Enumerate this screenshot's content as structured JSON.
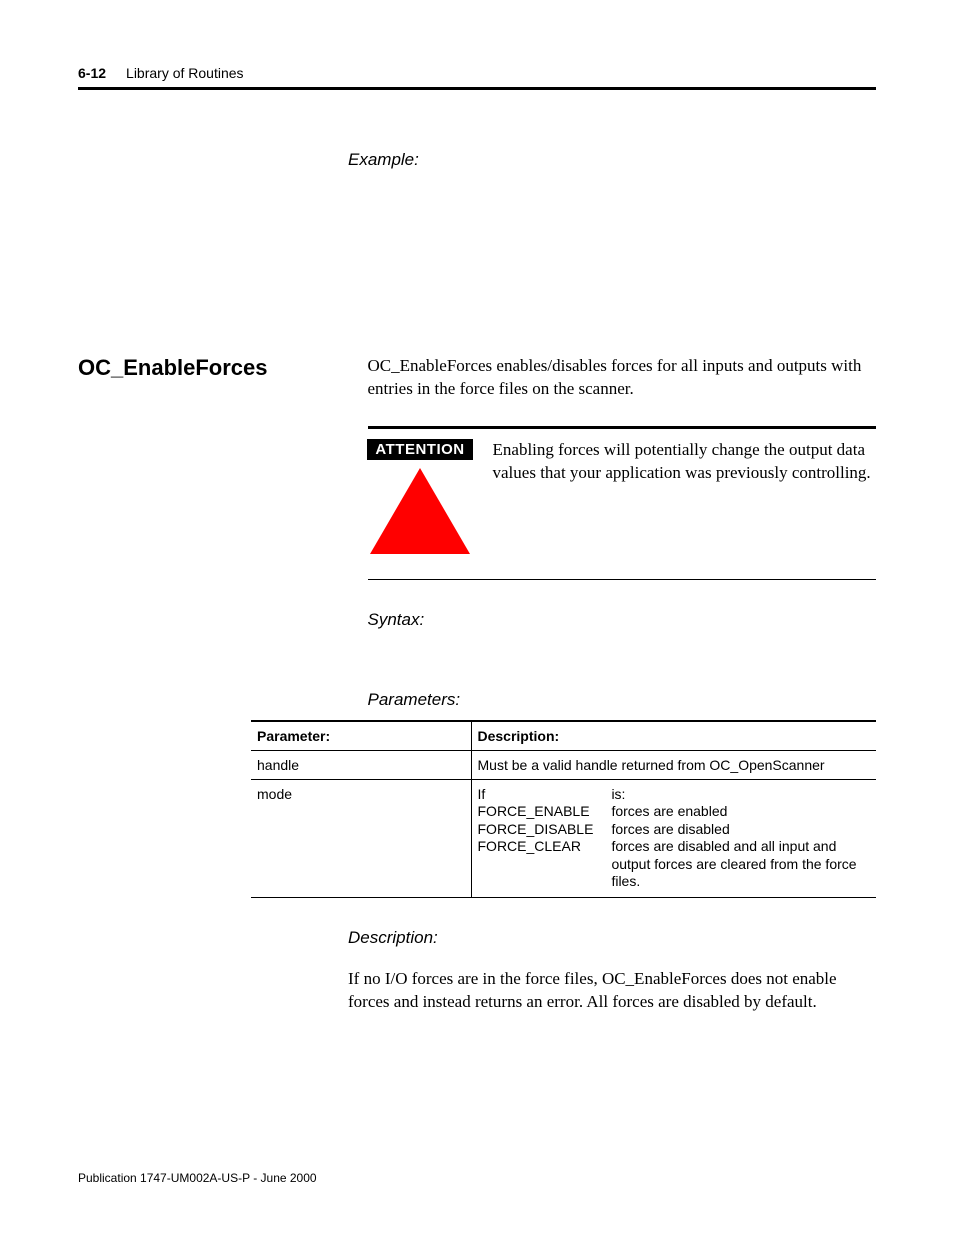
{
  "header": {
    "page_number": "6-12",
    "title": "Library of Routines"
  },
  "labels": {
    "example": "Example:",
    "syntax": "Syntax:",
    "parameters": "Parameters:",
    "description": "Description:"
  },
  "section": {
    "title": "OC_EnableForces",
    "intro": "OC_EnableForces enables/disables forces for all inputs and outputs with entries in the force files on the scanner."
  },
  "attention": {
    "label": "ATTENTION",
    "text": "Enabling forces will potentially change the output data values that your application was previously controlling."
  },
  "params_table": {
    "header_param": "Parameter:",
    "header_desc": "Description:",
    "rows": [
      {
        "param": "handle",
        "desc": "Must be a valid handle returned from OC_OpenScanner"
      },
      {
        "param": "mode",
        "mode": {
          "if": "If",
          "is": "is:",
          "items": [
            {
              "name": "FORCE_ENABLE",
              "desc": "forces are enabled"
            },
            {
              "name": "FORCE_DISABLE",
              "desc": "forces are disabled"
            },
            {
              "name": "FORCE_CLEAR",
              "desc": "forces are disabled and all input and output forces are cleared from the force files."
            }
          ]
        }
      }
    ]
  },
  "description_body": "If no I/O forces are in the force files, OC_EnableForces does not enable forces and instead returns an error. All forces are disabled by default.",
  "footer": "Publication 1747-UM002A-US-P - June 2000"
}
